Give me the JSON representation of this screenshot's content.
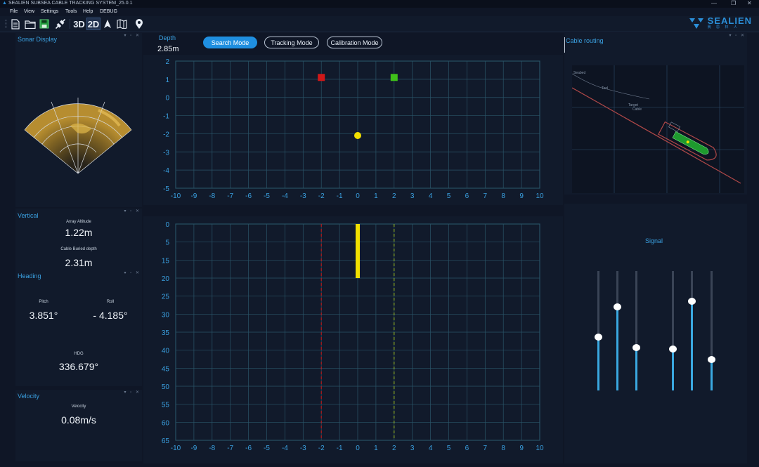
{
  "app": {
    "title": "SEALIEN SUBSEA CABLE TRACKING SYSTEM_25.0.1",
    "window_controls": [
      "—",
      "❐",
      "✕"
    ]
  },
  "menu": [
    "File",
    "View",
    "Settings",
    "Tools",
    "Help",
    "DEBUG"
  ],
  "toolbar": {
    "view_3d": "3D",
    "view_2d": "2D",
    "icons": [
      "new-file-icon",
      "open-folder-icon",
      "save-icon",
      "connect-icon",
      "3d-view",
      "2d-view",
      "navigate-icon",
      "map-icon",
      "location-pin-icon"
    ]
  },
  "logo": {
    "name": "SEALIEN",
    "subtitle": "赛 思 林 人"
  },
  "panels": {
    "sonar": {
      "title": "Sonar Display"
    },
    "vertical": {
      "title": "Vertical",
      "array_altitude_label": "Array Altitude",
      "array_altitude_value": "1.22m",
      "cable_buried_label": "Cable Buried depth",
      "cable_buried_value": "2.31m"
    },
    "heading": {
      "title": "Heading",
      "pitch_label": "Pitch",
      "pitch_value": "3.851°",
      "roll_label": "Roll",
      "roll_value": "- 4.185°",
      "hdg_label": "HDG",
      "hdg_value": "336.679°"
    },
    "velocity": {
      "title": "Velocity",
      "label": "Velocity",
      "value": "0.08m/s"
    },
    "depth": {
      "label": "Depth",
      "value": "2.85m"
    },
    "modes": {
      "search": "Search Mode",
      "tracking": "Tracking Mode",
      "calibration": "Calibration Mode",
      "active": "search"
    },
    "cable_routing": {
      "title": "Cable routing",
      "map_labels": [
        "Seabed",
        "Tool",
        "Target",
        "Cable"
      ]
    },
    "signal": {
      "title": "Signal",
      "levels": [
        0.45,
        0.7,
        0.36,
        0.35,
        0.75,
        0.26
      ]
    },
    "panel_controls": "▾ ▫ ✕"
  },
  "chart_data": [
    {
      "type": "scatter",
      "title": "",
      "xlim": [
        -10,
        10
      ],
      "ylim": [
        -5,
        2
      ],
      "x_ticks": [
        -10,
        -9,
        -8,
        -7,
        -6,
        -5,
        -4,
        -3,
        -2,
        -1,
        0,
        1,
        2,
        3,
        4,
        5,
        6,
        7,
        8,
        9,
        10
      ],
      "y_ticks": [
        2,
        1,
        0,
        -1,
        -2,
        -3,
        -4,
        -5
      ],
      "points": [
        {
          "x": -2,
          "y": 1.1,
          "shape": "square",
          "color": "#d01818"
        },
        {
          "x": 2,
          "y": 1.1,
          "shape": "square",
          "color": "#3fc01a"
        },
        {
          "x": 0,
          "y": -2.1,
          "shape": "circle",
          "color": "#f2e000"
        }
      ],
      "grid": true
    },
    {
      "type": "line",
      "title": "",
      "xlim": [
        -10,
        10
      ],
      "ylim": [
        0,
        65
      ],
      "y_inverted": true,
      "x_ticks": [
        -10,
        -9,
        -8,
        -7,
        -6,
        -5,
        -4,
        -3,
        -2,
        -1,
        0,
        1,
        2,
        3,
        4,
        5,
        6,
        7,
        8,
        9,
        10
      ],
      "y_ticks": [
        0,
        5,
        15,
        20,
        25,
        30,
        35,
        40,
        45,
        50,
        55,
        60,
        65
      ],
      "reference_lines": [
        {
          "x": -2,
          "style": "dashed",
          "color": "#d01818"
        },
        {
          "x": 2,
          "style": "dashed",
          "color": "#a0c020"
        }
      ],
      "bar": {
        "x": 0,
        "y_from": 0,
        "y_to": 20,
        "color": "#f2e000"
      },
      "grid": true
    }
  ]
}
